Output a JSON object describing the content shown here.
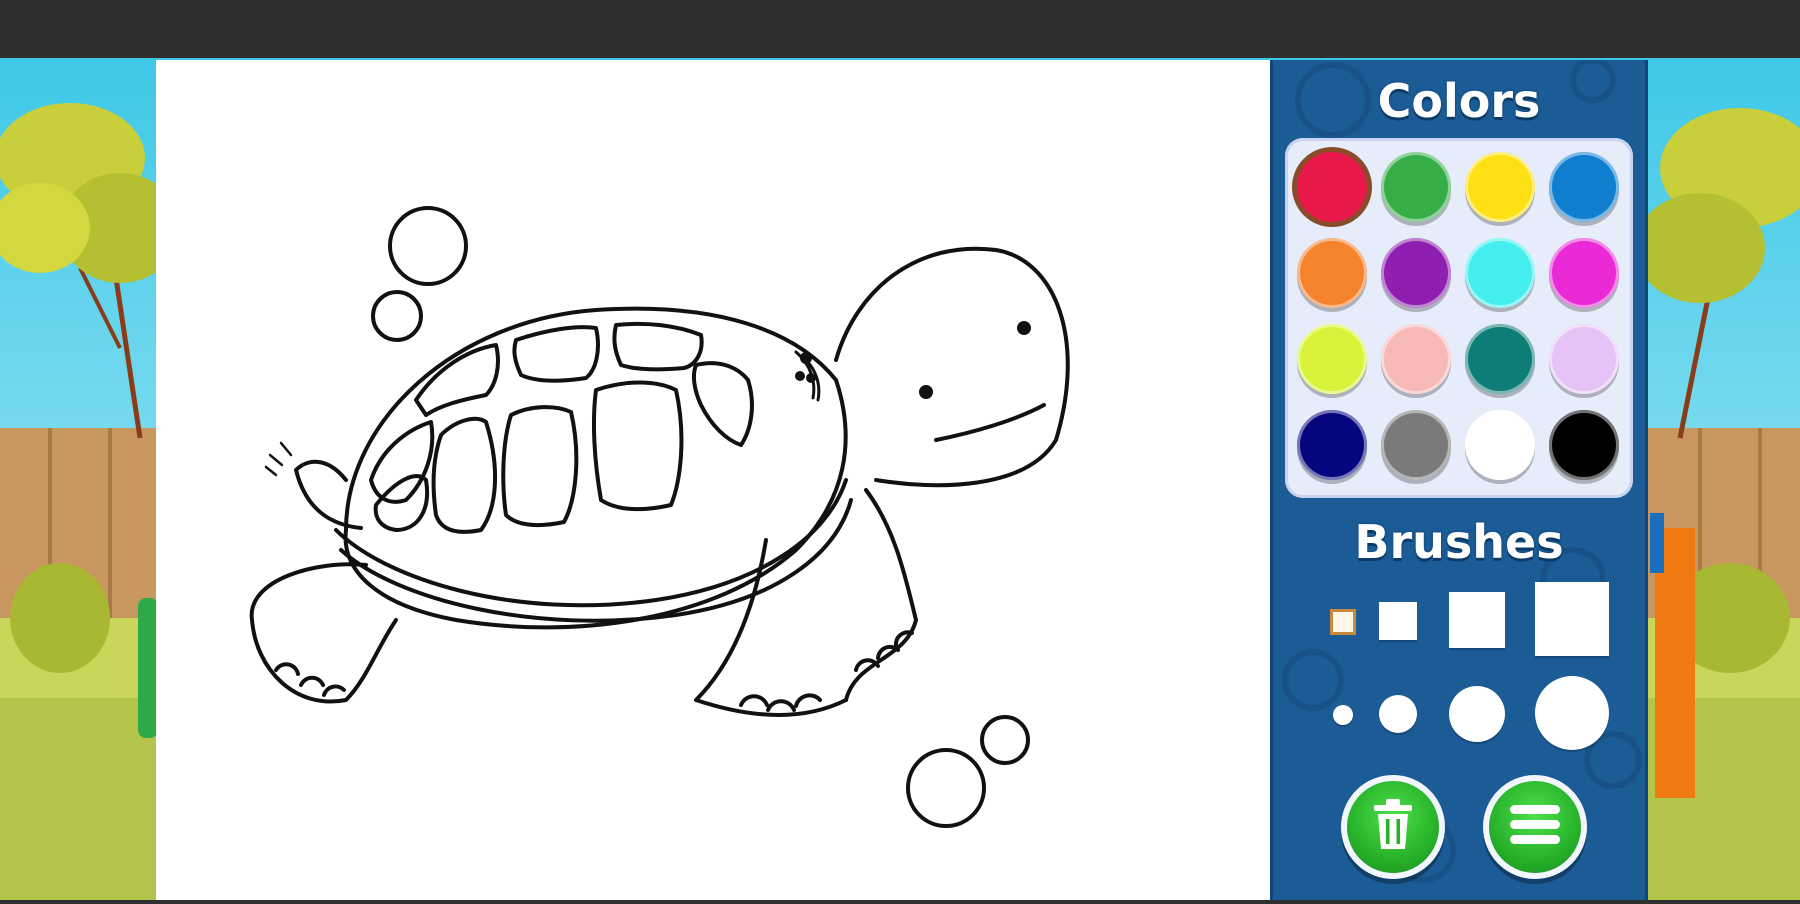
{
  "panel": {
    "colors_title": "Colors",
    "brushes_title": "Brushes",
    "swatches": [
      {
        "name": "red",
        "hex": "#e8194a"
      },
      {
        "name": "green",
        "hex": "#35ae48"
      },
      {
        "name": "yellow",
        "hex": "#fee014"
      },
      {
        "name": "blue",
        "hex": "#0f7ecf"
      },
      {
        "name": "orange",
        "hex": "#f5822d"
      },
      {
        "name": "purple",
        "hex": "#8e1fb0"
      },
      {
        "name": "cyan",
        "hex": "#44eeee"
      },
      {
        "name": "magenta",
        "hex": "#ea2ad6"
      },
      {
        "name": "lime",
        "hex": "#d9f33a"
      },
      {
        "name": "pink",
        "hex": "#f7b8b8"
      },
      {
        "name": "teal",
        "hex": "#0e7d78"
      },
      {
        "name": "lavender",
        "hex": "#e6c3f7"
      },
      {
        "name": "navy",
        "hex": "#05057d"
      },
      {
        "name": "gray",
        "hex": "#7a7a7a"
      },
      {
        "name": "white",
        "hex": "#ffffff"
      },
      {
        "name": "black",
        "hex": "#000000"
      }
    ],
    "selected_color": "red",
    "brushes": {
      "square_sizes": [
        "xs",
        "sm",
        "md",
        "lg"
      ],
      "round_sizes": [
        "xs",
        "sm",
        "md",
        "lg"
      ],
      "selected": "square-xs"
    },
    "buttons": {
      "clear_icon": "trash-icon",
      "menu_icon": "menu-icon"
    }
  },
  "colors": {
    "panel_bg": "#1b5b96",
    "button_green": "#27b22a",
    "canvas_bg": "#ffffff"
  }
}
